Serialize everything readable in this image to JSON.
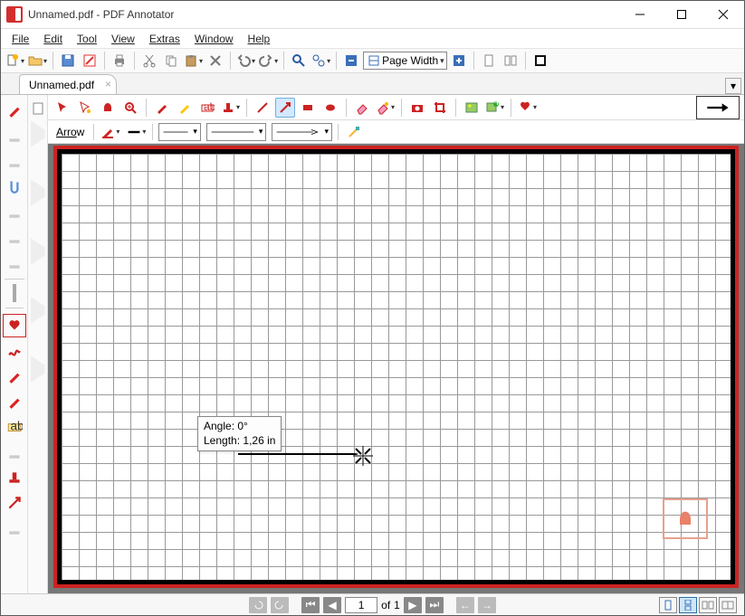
{
  "window_title": "Unnamed.pdf - PDF Annotator",
  "menus": {
    "file": "File",
    "edit": "Edit",
    "tool": "Tool",
    "view": "View",
    "extras": "Extras",
    "window": "Window",
    "help": "Help"
  },
  "zoom_mode": "Page Width",
  "tab_name": "Unnamed.pdf",
  "tool_label": "Arrow",
  "tooltip": {
    "angle_label": "Angle:",
    "angle_value": "0°",
    "length_label": "Length:",
    "length_value": "1,26 in"
  },
  "page_indicator": {
    "current": "1",
    "of_label": "of",
    "total": "1"
  },
  "colors": {
    "accent": "#d32f2f",
    "selection": "#cde6f7"
  }
}
